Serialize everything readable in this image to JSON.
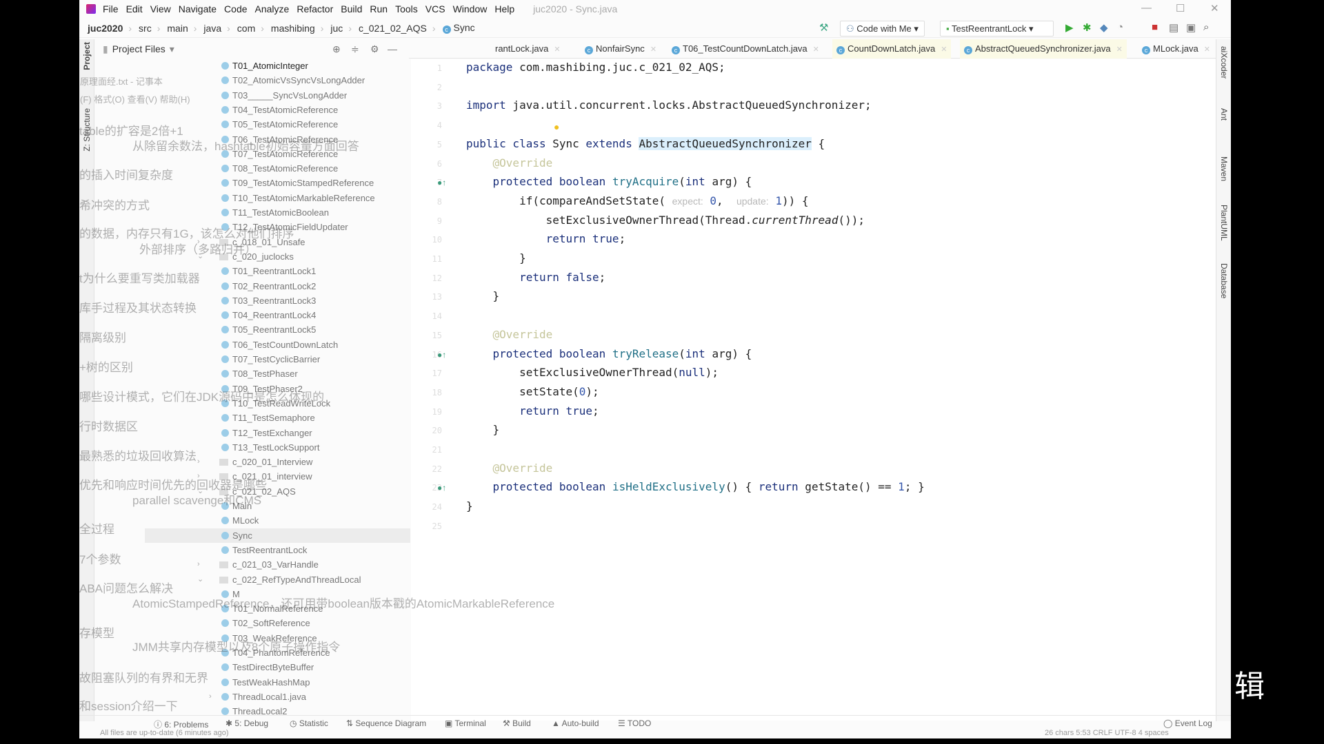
{
  "window": {
    "title": "juc2020 - Sync.java",
    "menu": [
      "File",
      "Edit",
      "View",
      "Navigate",
      "Code",
      "Analyze",
      "Refactor",
      "Build",
      "Run",
      "Tools",
      "VCS",
      "Window",
      "Help"
    ]
  },
  "breadcrumb": [
    "juc2020",
    "src",
    "main",
    "java",
    "com",
    "mashibing",
    "juc",
    "c_021_02_AQS",
    "Sync"
  ],
  "toolbar": {
    "code_with_me": "Code with Me",
    "run_config": "TestReentrantLock"
  },
  "project_panel": {
    "title": "Project Files"
  },
  "left_tools": [
    "Project",
    "Z: Structure"
  ],
  "right_tools": [
    "aiXcoder",
    "Ant",
    "Maven",
    "PlantUML",
    "Database"
  ],
  "tabs": [
    {
      "label": "rantLock.java",
      "lib": false,
      "active": false
    },
    {
      "label": "NonfairSync",
      "lib": false,
      "active": false
    },
    {
      "label": "T06_TestCountDownLatch.java",
      "lib": false,
      "active": false
    },
    {
      "label": "CountDownLatch.java",
      "lib": true,
      "active": false
    },
    {
      "label": "AbstractQueuedSynchronizer.java",
      "lib": true,
      "active": false
    },
    {
      "label": "MLock.java",
      "lib": false,
      "active": false
    },
    {
      "label": "Sync.java",
      "lib": false,
      "active": true
    }
  ],
  "tree": [
    {
      "label": "T01_AtomicInteger",
      "kind": "class",
      "strong": true
    },
    {
      "label": "T02_AtomicVsSyncVsLongAdder",
      "kind": "class"
    },
    {
      "label": "T03_____SyncVsLongAdder",
      "kind": "class"
    },
    {
      "label": "T04_TestAtomicReference",
      "kind": "class"
    },
    {
      "label": "T05_TestAtomicReference",
      "kind": "class"
    },
    {
      "label": "T06_TestAtomicReference",
      "kind": "class"
    },
    {
      "label": "T07_TestAtomicReference",
      "kind": "class"
    },
    {
      "label": "T08_TestAtomicReference",
      "kind": "class"
    },
    {
      "label": "T09_TestAtomicStampedReference",
      "kind": "class"
    },
    {
      "label": "T10_TestAtomicMarkableReference",
      "kind": "class"
    },
    {
      "label": "T11_TestAtomicBoolean",
      "kind": "class"
    },
    {
      "label": "T12_TestAtomicFieldUpdater",
      "kind": "class"
    },
    {
      "label": "c_018_01_Unsafe",
      "kind": "folder",
      "arrow": "collapsed"
    },
    {
      "label": "c_020_juclocks",
      "kind": "folder",
      "arrow": "expanded"
    },
    {
      "label": "T01_ReentrantLock1",
      "kind": "class"
    },
    {
      "label": "T02_ReentrantLock2",
      "kind": "class"
    },
    {
      "label": "T03_ReentrantLock3",
      "kind": "class"
    },
    {
      "label": "T04_ReentrantLock4",
      "kind": "class"
    },
    {
      "label": "T05_ReentrantLock5",
      "kind": "class"
    },
    {
      "label": "T06_TestCountDownLatch",
      "kind": "class"
    },
    {
      "label": "T07_TestCyclicBarrier",
      "kind": "class"
    },
    {
      "label": "T08_TestPhaser",
      "kind": "class"
    },
    {
      "label": "T09_TestPhaser2",
      "kind": "class"
    },
    {
      "label": "T10_TestReadWriteLock",
      "kind": "class"
    },
    {
      "label": "T11_TestSemaphore",
      "kind": "class"
    },
    {
      "label": "T12_TestExchanger",
      "kind": "class"
    },
    {
      "label": "T13_TestLockSupport",
      "kind": "class"
    },
    {
      "label": "c_020_01_Interview",
      "kind": "folder",
      "arrow": "collapsed"
    },
    {
      "label": "c_021_01_interview",
      "kind": "folder",
      "arrow": "collapsed"
    },
    {
      "label": "c_021_02_AQS",
      "kind": "folder",
      "arrow": "expanded"
    },
    {
      "label": "Main",
      "kind": "class"
    },
    {
      "label": "MLock",
      "kind": "class"
    },
    {
      "label": "Sync",
      "kind": "class",
      "selected": true
    },
    {
      "label": "TestReentrantLock",
      "kind": "class"
    },
    {
      "label": "c_021_03_VarHandle",
      "kind": "folder",
      "arrow": "collapsed"
    },
    {
      "label": "c_022_RefTypeAndThreadLocal",
      "kind": "folder",
      "arrow": "expanded"
    },
    {
      "label": "M",
      "kind": "class"
    },
    {
      "label": "T01_NormalReference",
      "kind": "class"
    },
    {
      "label": "T02_SoftReference",
      "kind": "class"
    },
    {
      "label": "T03_WeakReference",
      "kind": "class"
    },
    {
      "label": "T04_PhantomReference",
      "kind": "class"
    },
    {
      "label": "TestDirectByteBuffer",
      "kind": "class"
    },
    {
      "label": "TestWeakHashMap",
      "kind": "class"
    },
    {
      "label": "ThreadLocal1.java",
      "kind": "class",
      "arrow": "collapsed"
    },
    {
      "label": "ThreadLocal2",
      "kind": "class"
    }
  ],
  "code": [
    [
      [
        "package",
        "kw"
      ],
      [
        " com.mashibing.juc.c_021_02_AQS;",
        ""
      ]
    ],
    [],
    [
      [
        "import",
        "kw"
      ],
      [
        " java.util.concurrent.locks.AbstractQueuedSynchronizer;",
        ""
      ]
    ],
    [],
    [
      [
        "public class",
        "kw"
      ],
      [
        " Sync ",
        ""
      ],
      [
        "extends",
        "kw"
      ],
      [
        " ",
        ""
      ],
      [
        "AbstractQueuedSynchronizer",
        "hl"
      ],
      [
        " {",
        ""
      ]
    ],
    [
      [
        "    ",
        ""
      ],
      [
        "@Override",
        "an"
      ]
    ],
    [
      [
        "    ",
        ""
      ],
      [
        "protected boolean",
        "kw"
      ],
      [
        " ",
        ""
      ],
      [
        "tryAcquire",
        "fn"
      ],
      [
        "(",
        ""
      ],
      [
        "int",
        "kw"
      ],
      [
        " arg) {",
        ""
      ]
    ],
    [
      [
        "        if(compareAndSetState( ",
        ""
      ],
      [
        "expect:",
        "hint"
      ],
      [
        " ",
        ""
      ],
      [
        "0",
        "num"
      ],
      [
        ",  ",
        ""
      ],
      [
        "update:",
        "hint"
      ],
      [
        " ",
        ""
      ],
      [
        "1",
        "num"
      ],
      [
        ")) {",
        ""
      ]
    ],
    [
      [
        "            setExclusiveOwnerThread(Thread.",
        ""
      ],
      [
        "currentThread",
        "it"
      ],
      [
        "());",
        ""
      ]
    ],
    [
      [
        "            ",
        ""
      ],
      [
        "return true",
        "kw"
      ],
      [
        ";",
        ""
      ]
    ],
    [
      [
        "        }",
        ""
      ]
    ],
    [
      [
        "        ",
        ""
      ],
      [
        "return false",
        "kw"
      ],
      [
        ";",
        ""
      ]
    ],
    [
      [
        "    }",
        ""
      ]
    ],
    [],
    [
      [
        "    ",
        ""
      ],
      [
        "@Override",
        "an"
      ]
    ],
    [
      [
        "    ",
        ""
      ],
      [
        "protected boolean",
        "kw"
      ],
      [
        " ",
        ""
      ],
      [
        "tryRelease",
        "fn"
      ],
      [
        "(",
        ""
      ],
      [
        "int",
        "kw"
      ],
      [
        " arg) {",
        ""
      ]
    ],
    [
      [
        "        setExclusiveOwnerThread(",
        ""
      ],
      [
        "null",
        "kw"
      ],
      [
        ");",
        ""
      ]
    ],
    [
      [
        "        setState(",
        ""
      ],
      [
        "0",
        "num"
      ],
      [
        ");",
        ""
      ]
    ],
    [
      [
        "        ",
        ""
      ],
      [
        "return true",
        "kw"
      ],
      [
        ";",
        ""
      ]
    ],
    [
      [
        "    }",
        ""
      ]
    ],
    [],
    [
      [
        "    ",
        ""
      ],
      [
        "@Override",
        "an"
      ]
    ],
    [
      [
        "    ",
        ""
      ],
      [
        "protected boolean",
        "kw"
      ],
      [
        " ",
        ""
      ],
      [
        "isHeldExclusively",
        "fn"
      ],
      [
        "() { ",
        ""
      ],
      [
        "return",
        "kw"
      ],
      [
        " getState() == ",
        ""
      ],
      [
        "1",
        "num"
      ],
      [
        "; }",
        ""
      ]
    ],
    [
      [
        "}",
        ""
      ]
    ],
    []
  ],
  "bottom_tools": [
    "6: Problems",
    "5: Debug",
    "Statistic",
    "Sequence Diagram",
    "Terminal",
    "Build",
    "Auto-build",
    "TODO",
    "Event Log"
  ],
  "status": {
    "message": "All files are up-to-date (6 minutes ago)",
    "right": "26 chars  5:53  CRLF  UTF-8  4 spaces"
  },
  "overlay_notes": [
    "原理面经.txt - 记事本",
    "(F)  格式(O)  查看(V)  帮助(H)",
    "table的扩容是2倍+1",
    "从除留余数法，hashtable初始容量方面回答",
    "的插入时间复杂度",
    "希冲突的方式",
    "的数据，内存只有1G，该怎么对他们排序",
    "外部排序（多路归并）",
    "t为什么要重写类加载器",
    "库手过程及其状态转换",
    "隔离级别",
    "+树的区别",
    "哪些设计模式，它们在JDK源码中是怎么体现的",
    "行时数据区",
    "最熟悉的垃圾回收算法",
    "优先和响应时间优先的回收器是哪些",
    "parallel scavenge和CMS",
    "全过程",
    "7个参数",
    "ABA问题怎么解决",
    "AtomicStampedReference，还可用带boolean版本戳的AtomicMarkableReference",
    "存模型",
    "JMM共享内存模型以及8个原子操作指令",
    "故阻塞队列的有界和无界",
    "和session介绍一下"
  ],
  "side_char": "辑"
}
